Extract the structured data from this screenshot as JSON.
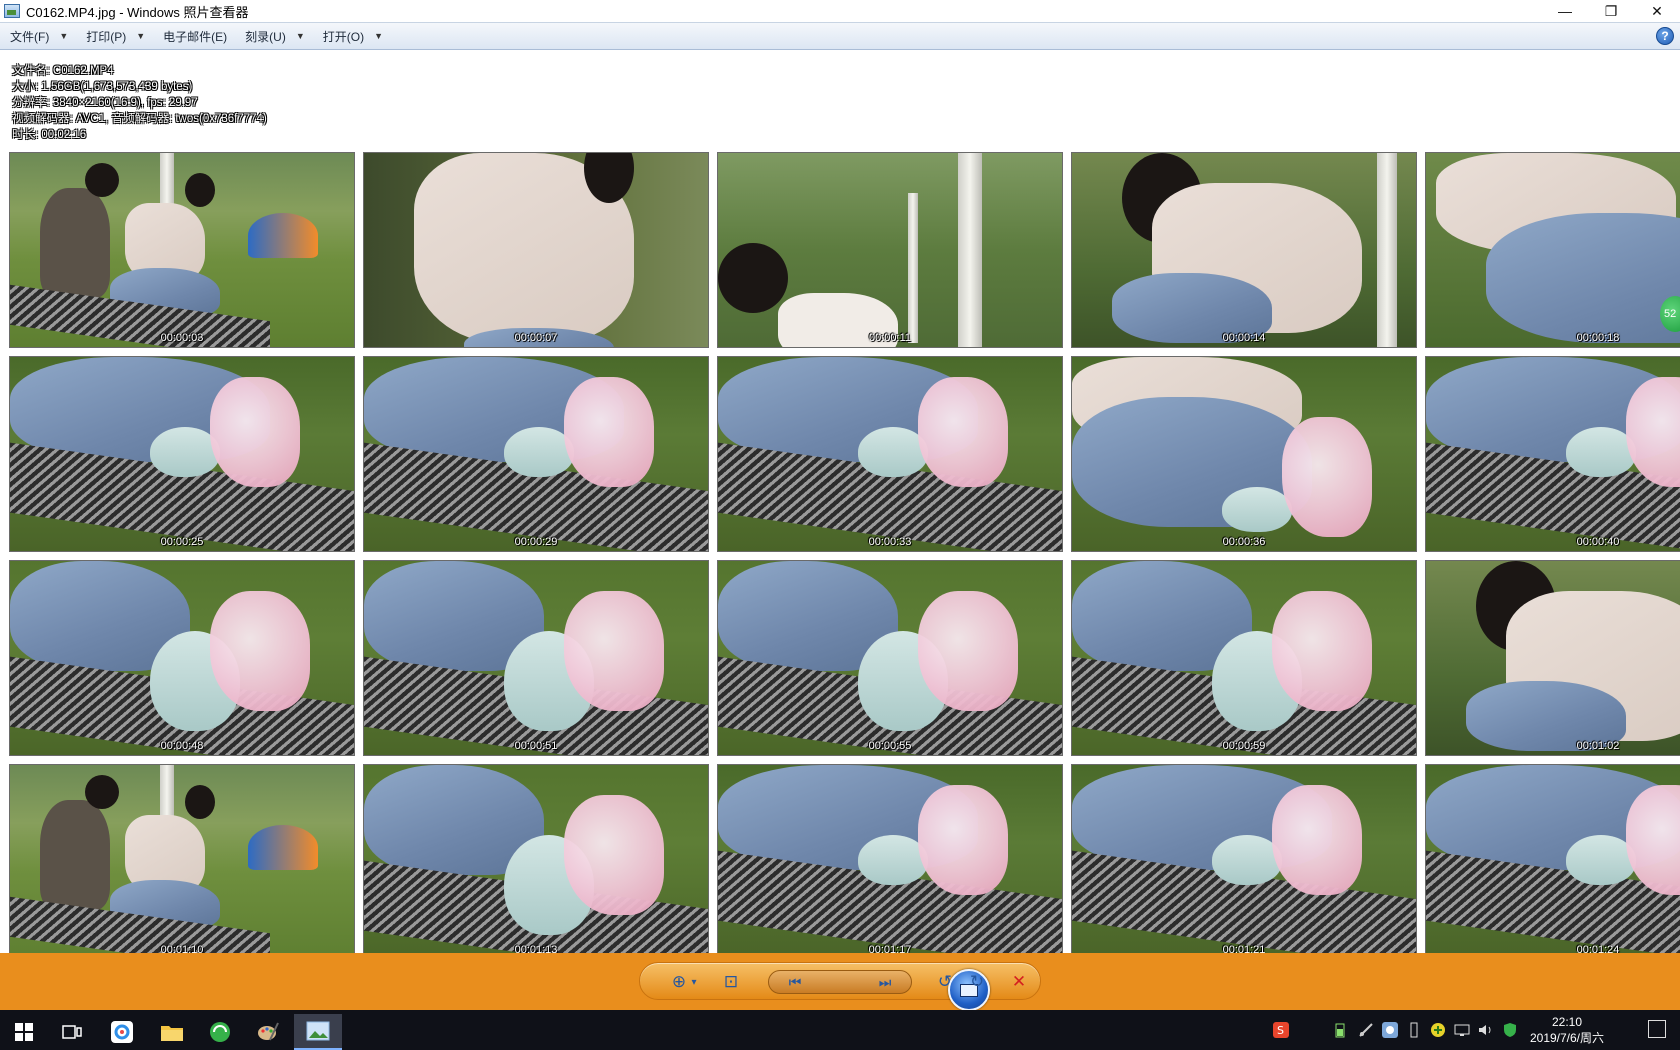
{
  "window": {
    "title": "C0162.MP4.jpg - Windows 照片查看器",
    "controls": {
      "minimize": "—",
      "restore": "❐",
      "close": "✕"
    }
  },
  "menu": {
    "items": [
      {
        "label": "文件(F)",
        "has_arrow": true
      },
      {
        "label": "打印(P)",
        "has_arrow": true
      },
      {
        "label": "电子邮件(E)",
        "has_arrow": false
      },
      {
        "label": "刻录(U)",
        "has_arrow": true
      },
      {
        "label": "打开(O)",
        "has_arrow": true
      }
    ],
    "arrow_glyph": "▼",
    "help": "?"
  },
  "info": {
    "filename": "文件名: C0162.MP4",
    "size": "大小: 1.56GB(1,673,573,439 bytes)",
    "resolution": "分辨率: 3840×2160(16:9), fps: 29.97",
    "codec": "视频解码器: AVC1, 音频解码器: twos(0x736f7774)",
    "duration": "时长: 00:02:16"
  },
  "thumbnails": [
    {
      "time": "00:00:03",
      "scene": "wide"
    },
    {
      "time": "00:00:07",
      "scene": "jacket"
    },
    {
      "time": "00:00:11",
      "scene": "trees"
    },
    {
      "time": "00:00:14",
      "scene": "kneel"
    },
    {
      "time": "00:00:18",
      "scene": "jeans"
    },
    {
      "time": "00:00:25",
      "scene": "feet"
    },
    {
      "time": "00:00:29",
      "scene": "feet"
    },
    {
      "time": "00:00:33",
      "scene": "feet"
    },
    {
      "time": "00:00:36",
      "scene": "jacket-feet"
    },
    {
      "time": "00:00:40",
      "scene": "feet"
    },
    {
      "time": "00:00:48",
      "scene": "socks"
    },
    {
      "time": "00:00:51",
      "scene": "socks"
    },
    {
      "time": "00:00:55",
      "scene": "socks"
    },
    {
      "time": "00:00:59",
      "scene": "socks"
    },
    {
      "time": "00:01:02",
      "scene": "kneel"
    },
    {
      "time": "00:01:10",
      "scene": "wide"
    },
    {
      "time": "00:01:13",
      "scene": "socks"
    },
    {
      "time": "00:01:17",
      "scene": "feet"
    },
    {
      "time": "00:01:21",
      "scene": "feet"
    },
    {
      "time": "00:01:24",
      "scene": "feet"
    }
  ],
  "badge": "52",
  "toolbar": {
    "zoom": "⊕",
    "zoom_arrow": "▾",
    "actual_size": "⊡",
    "previous": "⏮",
    "next": "⏭",
    "rotate_left": "↺",
    "rotate_right": "↻",
    "delete": "✕"
  },
  "taskbar": {
    "clock_time": "22:10",
    "clock_date": "2019/7/6/周六"
  },
  "colors": {
    "toolbar_bg": "#e98e1d",
    "taskbar_bg": "#0f1118",
    "menubar_bg": "#dce6f3"
  }
}
